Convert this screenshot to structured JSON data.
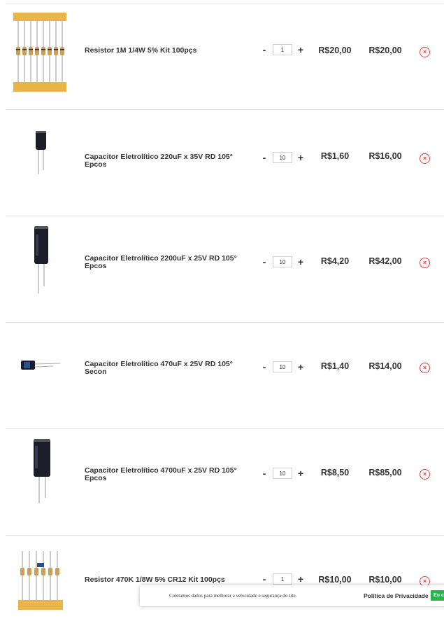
{
  "cart": {
    "items": [
      {
        "name": "Resistor 1M 1/4W 5% Kit 100pçs",
        "qty": "1",
        "price": "R$20,00",
        "total": "R$20,00",
        "remove_icon": "×"
      },
      {
        "name": "Capacitor Eletrolítico 220uF x 35V RD 105° Epcos",
        "qty": "10",
        "price": "R$1,60",
        "total": "R$16,00",
        "remove_icon": "×"
      },
      {
        "name": "Capacitor Eletrolítico 2200uF x 25V RD 105° Epcos",
        "qty": "10",
        "price": "R$4,20",
        "total": "R$42,00",
        "remove_icon": "×"
      },
      {
        "name": "Capacitor Eletrolítico 470uF x 25V RD 105° Secon",
        "qty": "10",
        "price": "R$1,40",
        "total": "R$14,00",
        "remove_icon": "×"
      },
      {
        "name": "Capacitor Eletrolítico 4700uF x 25V RD 105° Epcos",
        "qty": "10",
        "price": "R$8,50",
        "total": "R$85,00",
        "remove_icon": "×"
      },
      {
        "name": "Resistor 470K 1/8W 5% CR12 Kit 100pçs",
        "qty": "1",
        "price": "R$10,00",
        "total": "R$10,00",
        "remove_icon": "×"
      }
    ],
    "minus_label": "-",
    "plus_label": "+"
  },
  "cookie_bar": {
    "message": "Coletamos dados para melhorar a velocidade e segurança do site.",
    "policy_link": "Política de Privacidade",
    "accept_button": "Eu concordo"
  },
  "colors": {
    "remove": "#e0454d",
    "accept": "#2fb24b",
    "separator": "#e3e3e3"
  }
}
